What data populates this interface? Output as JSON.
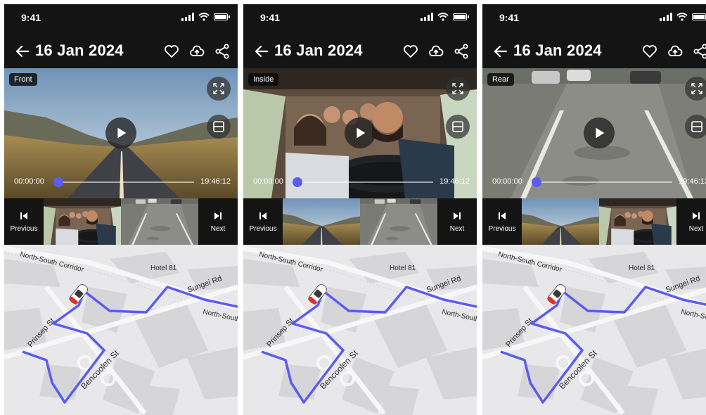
{
  "status_bar": {
    "time": "9:41"
  },
  "header": {
    "title": "16 Jan 2024"
  },
  "player": {
    "time_start": "00:00:00",
    "time_end": "19:46:12",
    "progress": 0.0
  },
  "nav": {
    "previous_label": "Previous",
    "next_label": "Next"
  },
  "map": {
    "labels": {
      "corridor": "North-South Corridor",
      "hotel": "Hotel 81",
      "sungei": "Sungei Rd",
      "north_south": "North-South",
      "prinsep": "Prinsep St",
      "bencoolen": "Bencoolen St"
    }
  },
  "screens": [
    {
      "camera": "Front",
      "view": "front",
      "thumb_a": "inside",
      "thumb_b": "rear"
    },
    {
      "camera": "Inside",
      "view": "inside",
      "thumb_a": "front",
      "thumb_b": "rear"
    },
    {
      "camera": "Rear",
      "view": "rear",
      "thumb_a": "front",
      "thumb_b": "inside"
    }
  ],
  "colors": {
    "accent": "#5a5cf0",
    "route": "#5a5cf0",
    "background": "#141414"
  },
  "icons": {
    "back": "back-arrow-icon",
    "like": "heart-icon",
    "upload": "cloud-upload-icon",
    "share": "share-icon",
    "fullscreen": "expand-icon",
    "layout": "split-view-icon",
    "play": "play-icon",
    "previous": "skip-previous-icon",
    "next": "skip-next-icon",
    "car": "car-icon"
  }
}
